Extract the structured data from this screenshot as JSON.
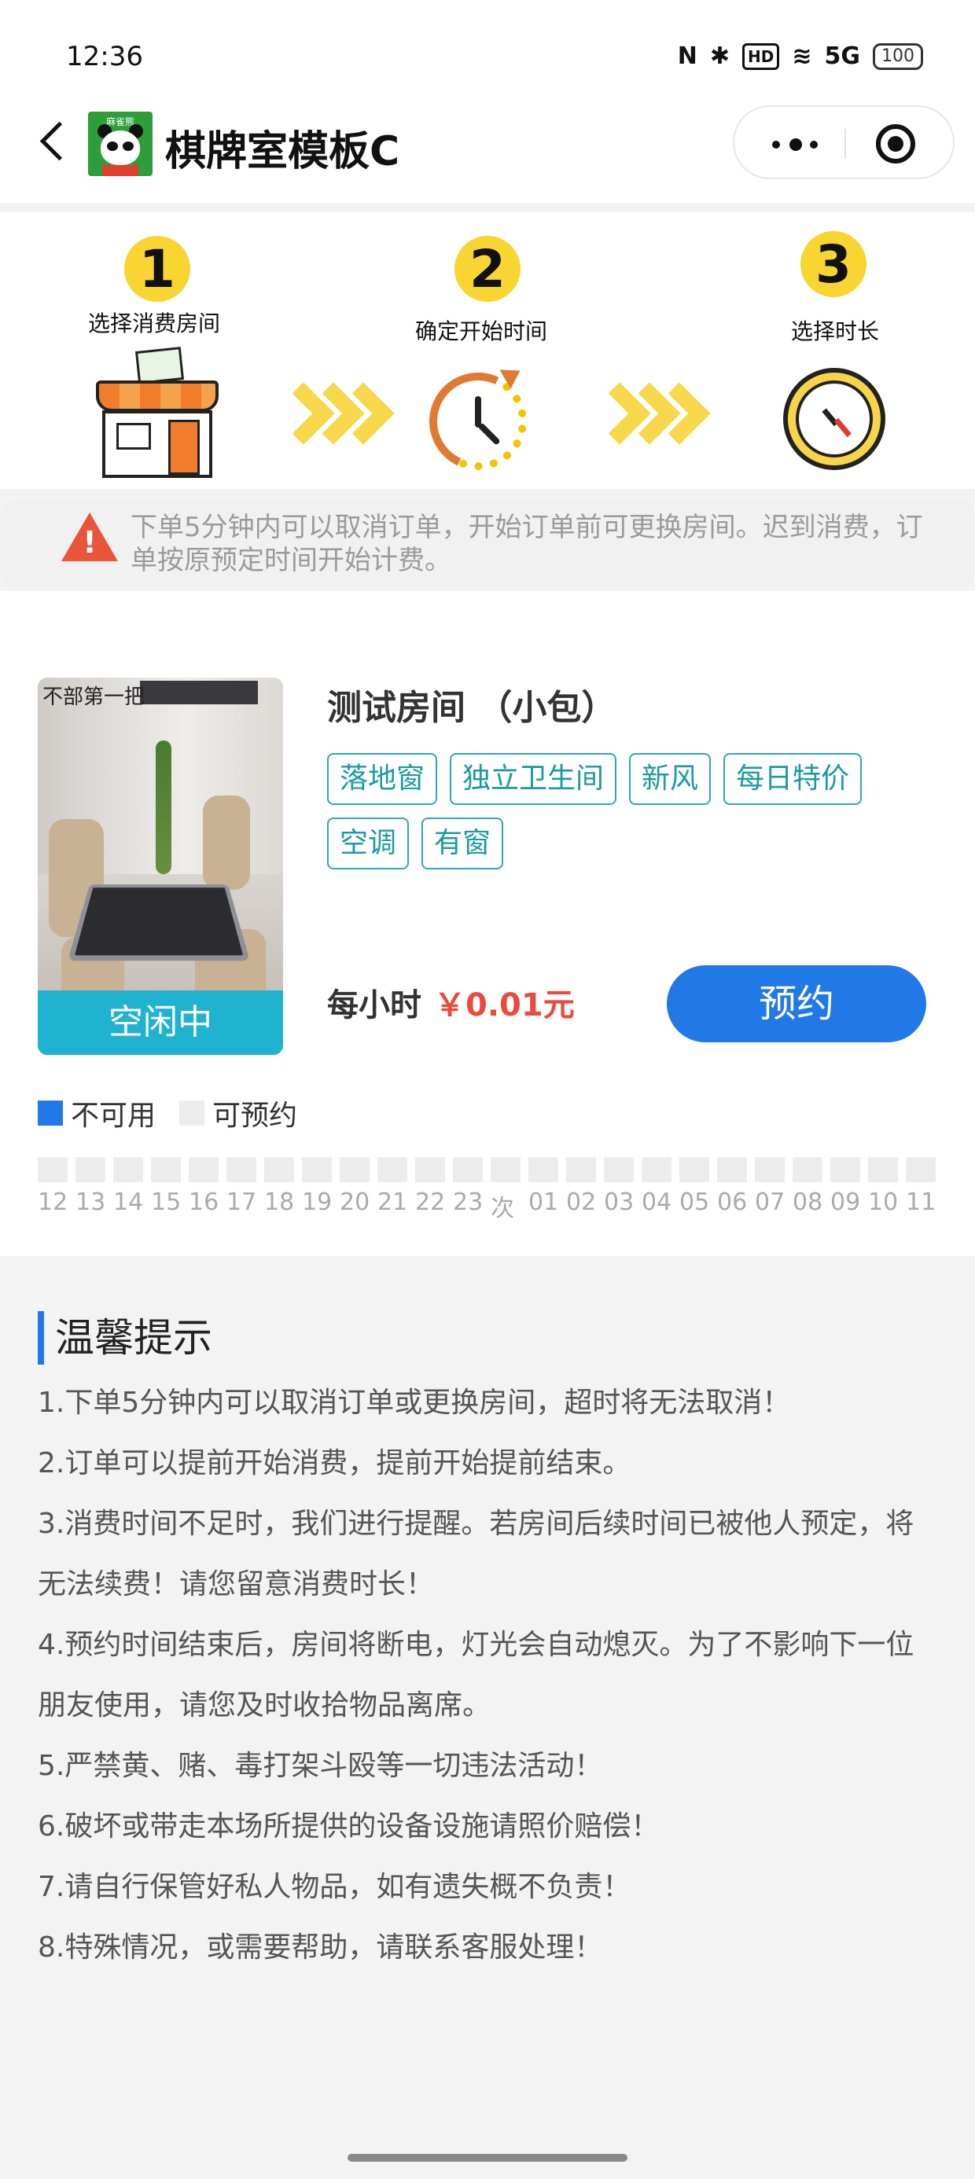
{
  "status_bar": {
    "time": "12:36",
    "nfc": "N",
    "bluetooth": "✱",
    "hd": "HD",
    "wifi": "≋",
    "signal": "5G",
    "battery": "100"
  },
  "nav": {
    "title": "棋牌室模板C",
    "logo_text": "麻雀熊"
  },
  "steps": [
    {
      "number": "1",
      "label": "选择消费房间"
    },
    {
      "number": "2",
      "label": "确定开始时间"
    },
    {
      "number": "3",
      "label": "选择时长"
    }
  ],
  "notice": {
    "text": "下单5分钟内可以取消订单，开始订单前可更换房间。迟到消费，订单按原预定时间开始计费。"
  },
  "room": {
    "photo_sign": "不部第一把",
    "status": "空闲中",
    "name": "测试房间 （小包）",
    "tags": [
      "落地窗",
      "独立卫生间",
      "新风",
      "每日特价",
      "空调",
      "有窗"
    ],
    "price_label": "每小时",
    "price": "￥0.01元",
    "book_label": "预约"
  },
  "legend": {
    "unavailable": "不可用",
    "available": "可预约",
    "colors": {
      "unavailable": "#2179e8",
      "available": "#ececec"
    }
  },
  "timeline_hours": [
    "12",
    "13",
    "14",
    "15",
    "16",
    "17",
    "18",
    "19",
    "20",
    "21",
    "22",
    "23",
    "次",
    "01",
    "02",
    "03",
    "04",
    "05",
    "06",
    "07",
    "08",
    "09",
    "10",
    "11"
  ],
  "tips": {
    "title": "温馨提示",
    "items": [
      "1.下单5分钟内可以取消订单或更换房间，超时将无法取消！",
      "2.订单可以提前开始消费，提前开始提前结束。",
      "3.消费时间不足时，我们进行提醒。若房间后续时间已被他人预定，将无法续费！请您留意消费时长！",
      "4.预约时间结束后，房间将断电，灯光会自动熄灭。为了不影响下一位朋友使用，请您及时收拾物品离席。",
      "5.严禁黄、赌、毒打架斗殴等一切违法活动！",
      "6.破坏或带走本场所提供的设备设施请照价赔偿！",
      "7.请自行保管好私人物品，如有遗失概不负责！",
      "8.特殊情况，或需要帮助，请联系客服处理！"
    ]
  },
  "colors": {
    "accent": "#2179e8",
    "status_cyan": "#1fb3d1",
    "price_red": "#e94b3c",
    "tag_teal": "#1b9aa3",
    "step_yellow": "#f9d532"
  }
}
